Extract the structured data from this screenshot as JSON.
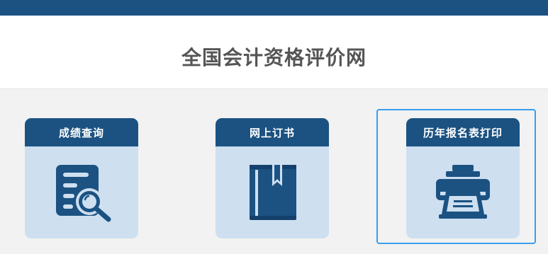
{
  "header": {
    "title": "全国会计资格评价网"
  },
  "cards": [
    {
      "label": "成绩查询",
      "icon": "score-search-icon"
    },
    {
      "label": "网上订书",
      "icon": "book-icon"
    },
    {
      "label": "历年报名表打印",
      "icon": "printer-icon"
    }
  ],
  "colors": {
    "primary": "#1b5282",
    "card_body": "#cedff0",
    "focus": "#3a9df0",
    "title_text": "#555555"
  }
}
